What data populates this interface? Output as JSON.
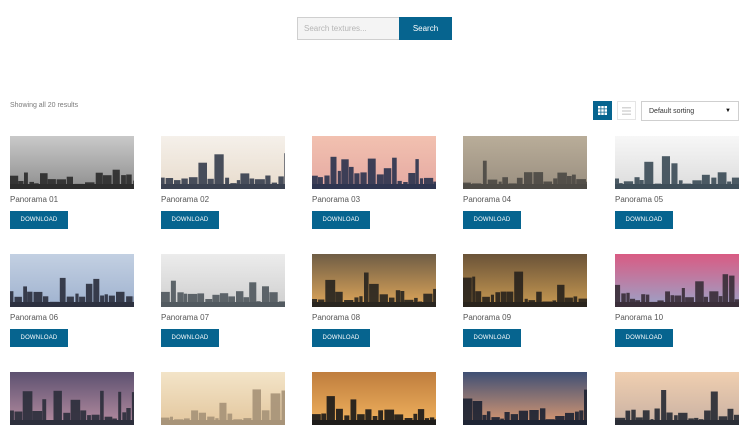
{
  "search": {
    "placeholder": "Search textures...",
    "button_label": "Search"
  },
  "toolbar": {
    "result_count": "Showing all 20 results",
    "sort_selected": "Default sorting"
  },
  "products": [
    {
      "title": "Panorama 01",
      "button": "DOWNLOAD",
      "palette": {
        "sky_top": "#c9c9c9",
        "sky_bottom": "#8f8f8f",
        "city": "#2d2d2d"
      }
    },
    {
      "title": "Panorama 02",
      "button": "DOWNLOAD",
      "palette": {
        "sky_top": "#f5f0ea",
        "sky_bottom": "#e8dccd",
        "city": "#3a4150"
      }
    },
    {
      "title": "Panorama 03",
      "button": "DOWNLOAD",
      "palette": {
        "sky_top": "#f2c1b0",
        "sky_bottom": "#e5a9a2",
        "city": "#2e3550"
      }
    },
    {
      "title": "Panorama 04",
      "button": "DOWNLOAD",
      "palette": {
        "sky_top": "#b9ad99",
        "sky_bottom": "#9a8f80",
        "city": "#4d4a45"
      }
    },
    {
      "title": "Panorama 05",
      "button": "DOWNLOAD",
      "palette": {
        "sky_top": "#f7f7f7",
        "sky_bottom": "#dcdcdc",
        "city": "#3e4e59"
      }
    },
    {
      "title": "Panorama 06",
      "button": "DOWNLOAD",
      "palette": {
        "sky_top": "#c3d0e2",
        "sky_bottom": "#9fb2cf",
        "city": "#2d3140"
      }
    },
    {
      "title": "Panorama 07",
      "button": "DOWNLOAD",
      "palette": {
        "sky_top": "#ececec",
        "sky_bottom": "#cfcfcf",
        "city": "#525a60"
      }
    },
    {
      "title": "Panorama 08",
      "button": "DOWNLOAD",
      "palette": {
        "sky_top": "#6f5d45",
        "sky_bottom": "#e0a75a",
        "city": "#2a2620"
      }
    },
    {
      "title": "Panorama 09",
      "button": "DOWNLOAD",
      "palette": {
        "sky_top": "#6a5338",
        "sky_bottom": "#c99a52",
        "city": "#2a241d"
      }
    },
    {
      "title": "Panorama 10",
      "button": "DOWNLOAD",
      "palette": {
        "sky_top": "#d95b83",
        "sky_bottom": "#9ba3c8",
        "city": "#3b2f3a"
      }
    },
    {
      "title": "",
      "button": "",
      "palette": {
        "sky_top": "#5d5170",
        "sky_bottom": "#b58ca0",
        "city": "#2d2f3c"
      }
    },
    {
      "title": "",
      "button": "",
      "palette": {
        "sky_top": "#f3e4c8",
        "sky_bottom": "#e3c79e",
        "city": "#a89479"
      }
    },
    {
      "title": "",
      "button": "",
      "palette": {
        "sky_top": "#bf7d3e",
        "sky_bottom": "#f1b35e",
        "city": "#1e1c1a"
      }
    },
    {
      "title": "",
      "button": "",
      "palette": {
        "sky_top": "#3f4f74",
        "sky_bottom": "#dc9a72",
        "city": "#1e2434"
      }
    },
    {
      "title": "",
      "button": "",
      "palette": {
        "sky_top": "#f0cfb0",
        "sky_bottom": "#c9b1a3",
        "city": "#2a2d36"
      }
    }
  ],
  "colors": {
    "accent": "#06648f"
  },
  "icons": {
    "grid_view": "grid-icon",
    "list_view": "list-icon",
    "sort_caret": "caret-down-icon"
  }
}
